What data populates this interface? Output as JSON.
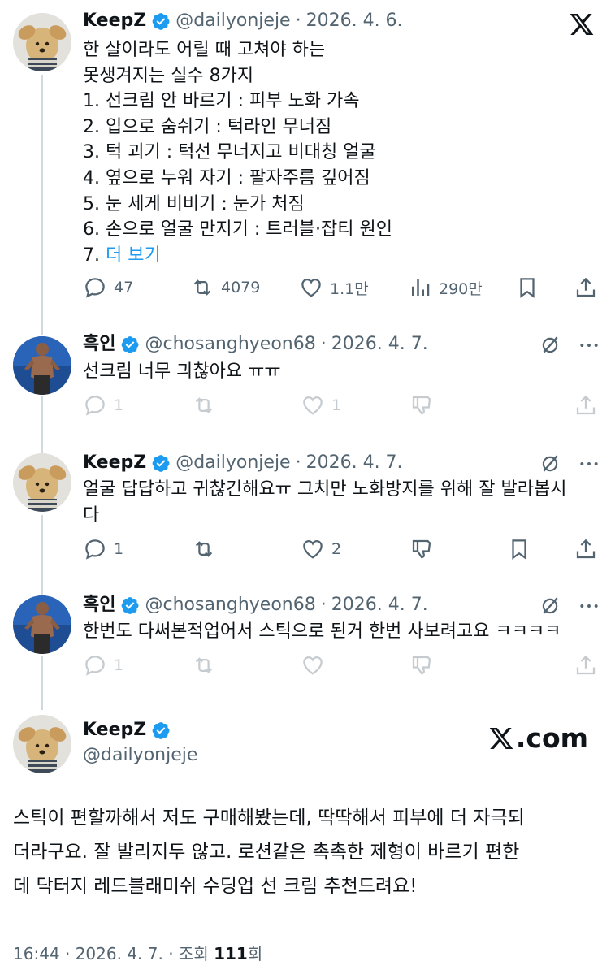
{
  "posts": [
    {
      "name": "KeepZ",
      "handle": "@dailyonjeje",
      "date": "2026. 4. 6.",
      "lines": [
        "한 살이라도 어릴 때 고쳐야 하는",
        "못생겨지는 실수 8가지",
        "1. 선크림 안 바르기 : 피부 노화 가속",
        "2. 입으로 숨쉬기 : 턱라인 무너짐",
        "3. 턱 괴기 : 턱선 무너지고 비대칭 얼굴",
        "4. 옆으로 누워 자기 : 팔자주름 깊어짐",
        "5. 눈 세게 비비기 : 눈가 처짐",
        "6. 손으로 얼굴 만지기 : 트러블·잡티 원인"
      ],
      "last_prefix": "7. ",
      "more_link": "더 보기",
      "replies": "47",
      "reposts": "4079",
      "likes": "1.1만",
      "views": "290만"
    },
    {
      "name": "흑인",
      "handle": "@chosanghyeon68",
      "date": "2026. 4. 7.",
      "text": "선크림 너무 긔찮아요 ㅠㅠ",
      "replies": "1",
      "likes": "1"
    },
    {
      "name": "KeepZ",
      "handle": "@dailyonjeje",
      "date": "2026. 4. 7.",
      "lines": [
        "얼굴 답답하고 귀찮긴해요ㅠ 그치만 노화방지를 위해 잘 발라봅시",
        "다"
      ],
      "replies": "1",
      "likes": "2"
    },
    {
      "name": "흑인",
      "handle": "@chosanghyeon68",
      "date": "2026. 4. 7.",
      "text": "한번도 다써본적업어서 스틱으로 된거 한번 사보려고요 ㅋㅋㅋㅋ",
      "replies": "1"
    }
  ],
  "card": {
    "name": "KeepZ",
    "handle": "@dailyonjeje",
    "brand": ".com",
    "lines": [
      "스틱이 편할까해서 저도 구매해봤는데, 딱딱해서 피부에 더 자극되",
      "더라구요. 잘 발리지두 않고. 로션같은 촉촉한 제형이 바르기 편한",
      "데 닥터지 레드블래미쉬 수딩업 선 크림 추천드려요!"
    ],
    "footer_time": "16:44 · 2026. 4. 7. · 조회 ",
    "footer_views": "111",
    "footer_suffix": "회"
  },
  "colors": {
    "accent": "#1d9bf0",
    "text": "#0f1419",
    "muted": "#536471",
    "line": "#cfd9de"
  },
  "icons": [
    "x-logo-icon",
    "verified-badge-icon",
    "reply-icon",
    "repost-icon",
    "like-icon",
    "views-icon",
    "bookmark-icon",
    "share-icon",
    "grok-icon",
    "more-icon",
    "downvote-icon"
  ]
}
